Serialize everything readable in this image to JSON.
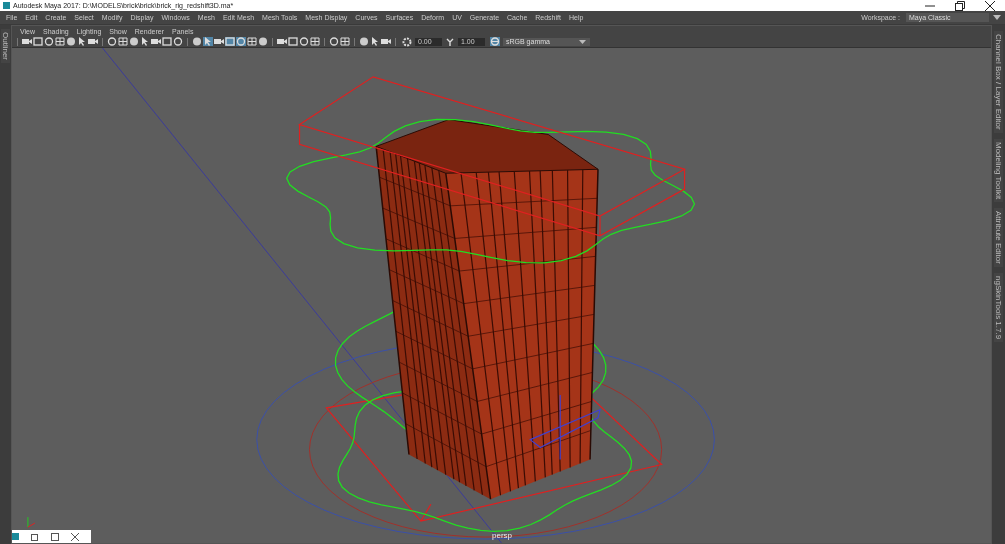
{
  "window": {
    "title": "Autodesk Maya 2017: D:\\MODELS\\brick\\brick\\brick_rig_redshift3D.ma*"
  },
  "menu": [
    "File",
    "Edit",
    "Create",
    "Select",
    "Modify",
    "Display",
    "Windows",
    "Mesh",
    "Edit Mesh",
    "Mesh Tools",
    "Mesh Display",
    "Curves",
    "Surfaces",
    "Deform",
    "UV",
    "Generate",
    "Cache",
    "Redshift",
    "Help"
  ],
  "workspace": {
    "label": "Workspace :",
    "value": "Maya Classic"
  },
  "left_tabs": [
    "Outliner"
  ],
  "panel_menu": [
    "View",
    "Shading",
    "Lighting",
    "Show",
    "Renderer",
    "Panels"
  ],
  "toolbar": {
    "groups": [
      {
        "icons": [
          {
            "selected": false
          },
          {
            "selected": false
          },
          {
            "selected": false
          },
          {
            "selected": false
          },
          {
            "selected": false
          },
          {
            "selected": false
          },
          {
            "selected": false
          }
        ]
      },
      {
        "icons": [
          {
            "selected": false
          },
          {
            "selected": false
          },
          {
            "selected": false
          },
          {
            "selected": false
          },
          {
            "selected": false
          },
          {
            "selected": false
          },
          {
            "selected": false
          }
        ]
      },
      {
        "icons": [
          {
            "selected": false
          },
          {
            "selected": true
          },
          {
            "selected": false
          },
          {
            "selected": true
          },
          {
            "selected": true
          },
          {
            "selected": false
          },
          {
            "selected": false
          }
        ]
      },
      {
        "icons": [
          {
            "selected": false
          },
          {
            "selected": false
          },
          {
            "selected": false
          },
          {
            "selected": false
          }
        ]
      },
      {
        "icons": [
          {
            "selected": false
          },
          {
            "selected": false
          }
        ]
      },
      {
        "icons": [
          {
            "selected": false
          },
          {
            "selected": false
          },
          {
            "selected": false
          }
        ]
      }
    ],
    "exposure": "0.00",
    "gamma": "1.00",
    "color_management": {
      "selected": true
    },
    "view_transform": "sRGB gamma"
  },
  "viewport": {
    "camera": "persp"
  },
  "right_tabs": [
    "Channel Box / Layer Editor",
    "Modeling Toolkit",
    "Attribute Editor",
    "ngSkinTools 1.7.9"
  ]
}
